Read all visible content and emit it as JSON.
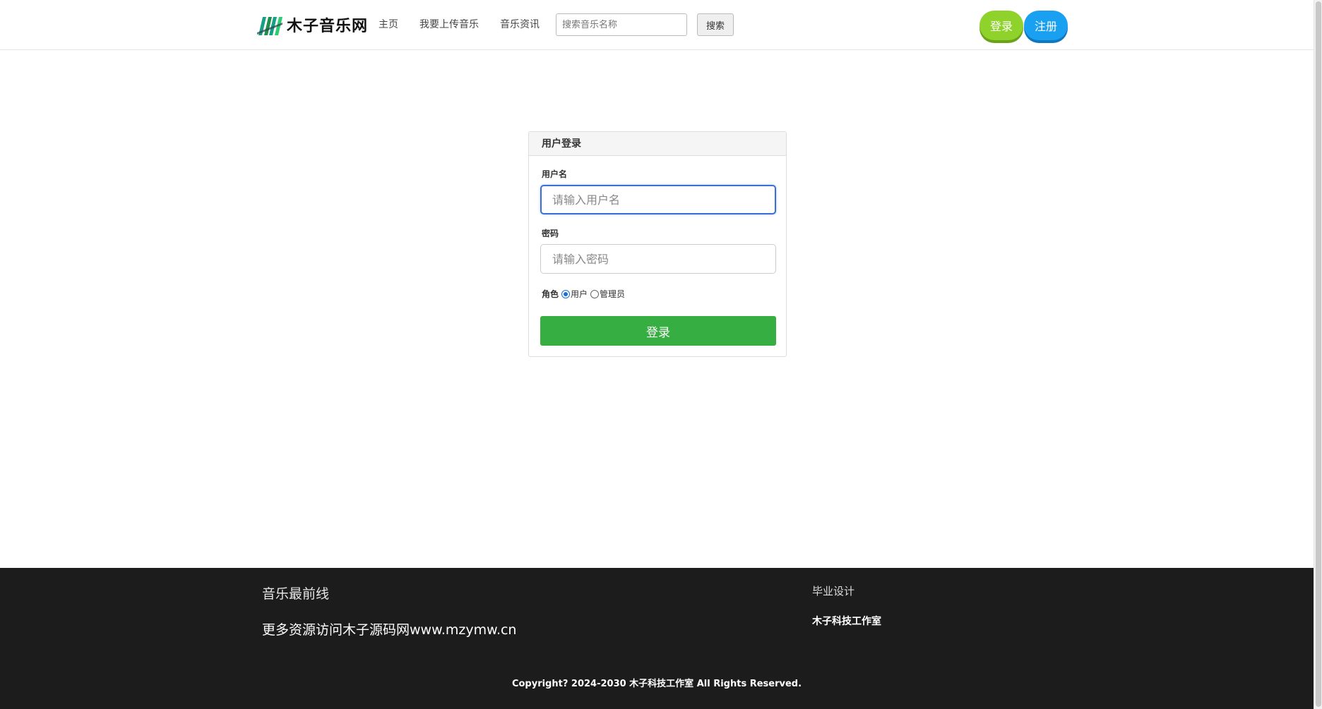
{
  "brand": {
    "name": "木子音乐网"
  },
  "nav": {
    "items": [
      {
        "label": "主页"
      },
      {
        "label": "我要上传音乐"
      },
      {
        "label": "音乐资讯"
      }
    ]
  },
  "search": {
    "placeholder": "搜索音乐名称",
    "button_label": "搜索"
  },
  "header_buttons": {
    "login": "登录",
    "register": "注册"
  },
  "login_panel": {
    "title": "用户登录",
    "username_label": "用户名",
    "username_placeholder": "请输入用户名",
    "password_label": "密码",
    "password_placeholder": "请输入密码",
    "role_label": "角色",
    "roles": [
      {
        "label": "用户",
        "checked": true
      },
      {
        "label": "管理员",
        "checked": false
      }
    ],
    "submit_label": "登录"
  },
  "footer": {
    "title": "音乐最前线",
    "promo": "更多资源访问木子源码网www.mzymw.cn",
    "column_title": "毕业设计",
    "column_item": "木子科技工作室",
    "copyright": "Copyright? 2024-2030 木子科技工作室 All Rights Reserved."
  },
  "colors": {
    "login_button_top": "#8fd22b",
    "register_button_top": "#1aa0f0",
    "submit_button": "#37ae41",
    "footer_bg": "#1c1c1c",
    "input_focus": "#3b6fd6"
  }
}
